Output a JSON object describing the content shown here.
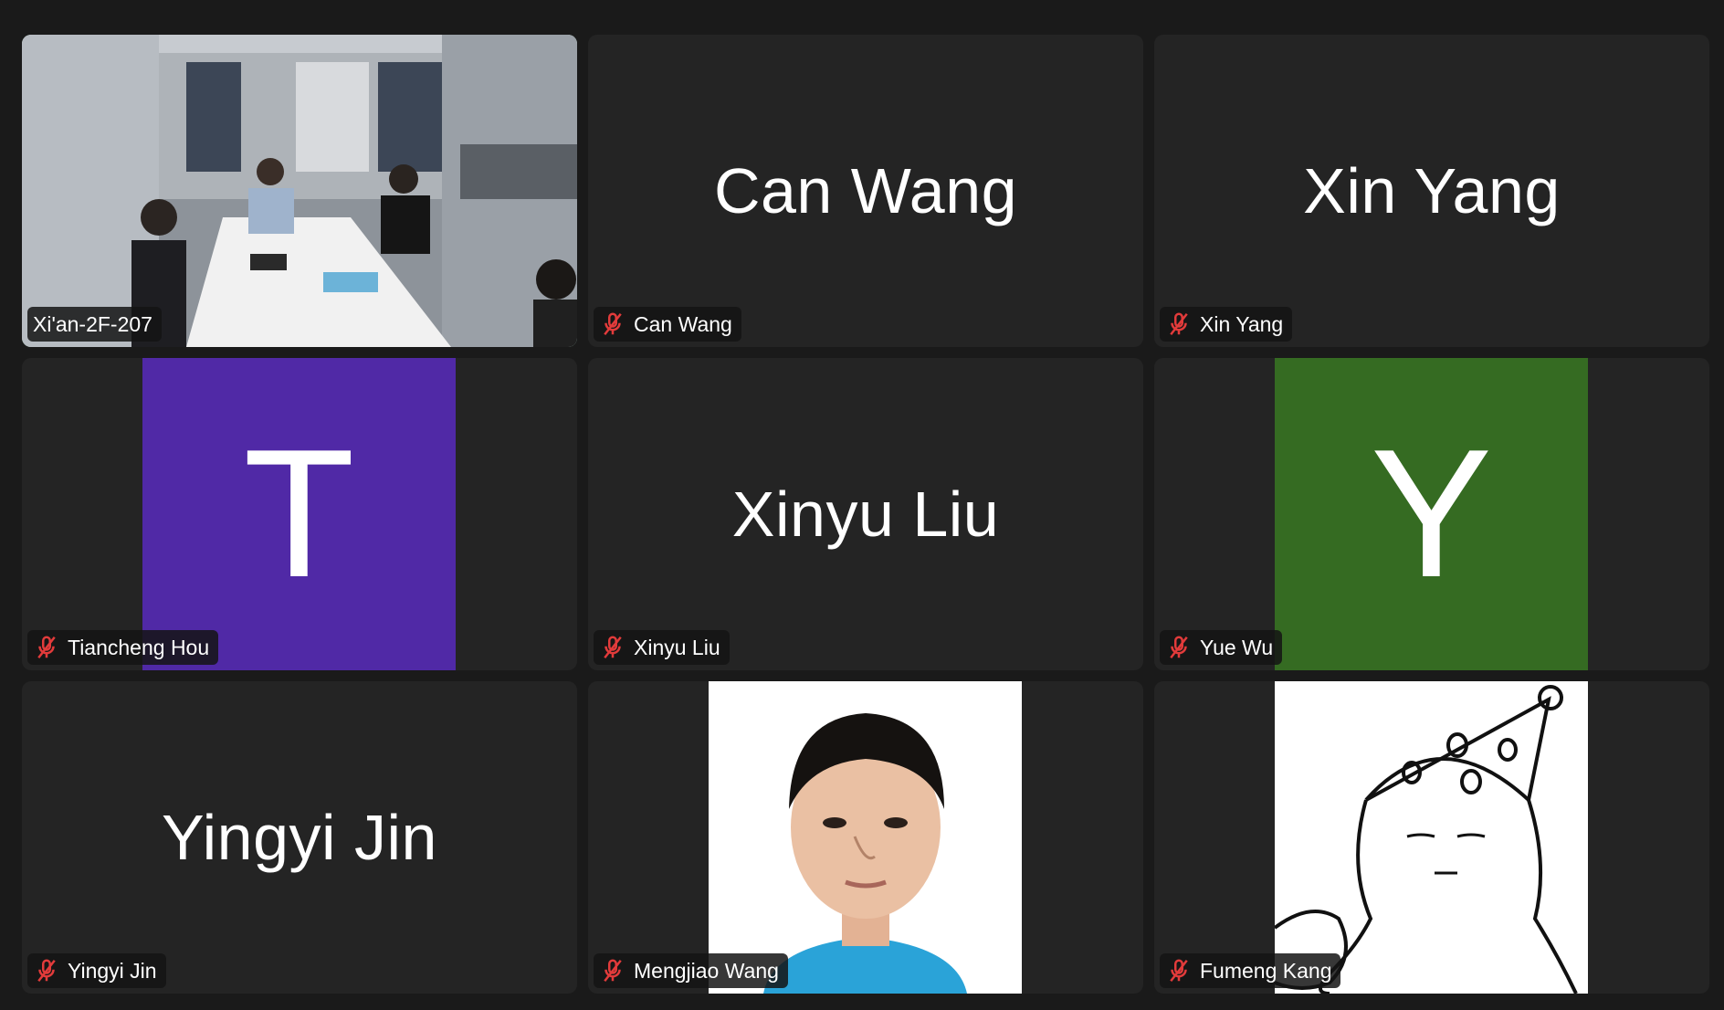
{
  "colors": {
    "background": "#1a1a1a",
    "tile_bg": "#242424",
    "active_border": "#3fd15a",
    "muted_mic": "#e23b3b",
    "avatar_purple": "#5029a6",
    "avatar_green": "#356b22"
  },
  "participants": [
    {
      "name": "Xi'an-2F-207",
      "tag": "Xi'an-2F-207",
      "type": "video",
      "muted": false,
      "active": true
    },
    {
      "name": "Can Wang",
      "tag": "Can Wang",
      "type": "name",
      "muted": true
    },
    {
      "name": "Xin Yang",
      "tag": "Xin Yang",
      "type": "name",
      "muted": true
    },
    {
      "name": "Tiancheng Hou",
      "tag": "Tiancheng Hou",
      "type": "letter",
      "letter": "T",
      "muted": true
    },
    {
      "name": "Xinyu Liu",
      "tag": "Xinyu Liu",
      "type": "name",
      "muted": true
    },
    {
      "name": "Yue Wu",
      "tag": "Yue Wu",
      "type": "letter",
      "letter": "Y",
      "muted": true
    },
    {
      "name": "Yingyi Jin",
      "tag": "Yingyi Jin",
      "type": "name",
      "muted": true
    },
    {
      "name": "Mengjiao Wang",
      "tag": "Mengjiao Wang",
      "type": "photo",
      "muted": true
    },
    {
      "name": "Fumeng Kang",
      "tag": "Fumeng Kang",
      "type": "drawing",
      "muted": true
    }
  ],
  "icons": {
    "muted_mic": "microphone-muted-icon"
  }
}
